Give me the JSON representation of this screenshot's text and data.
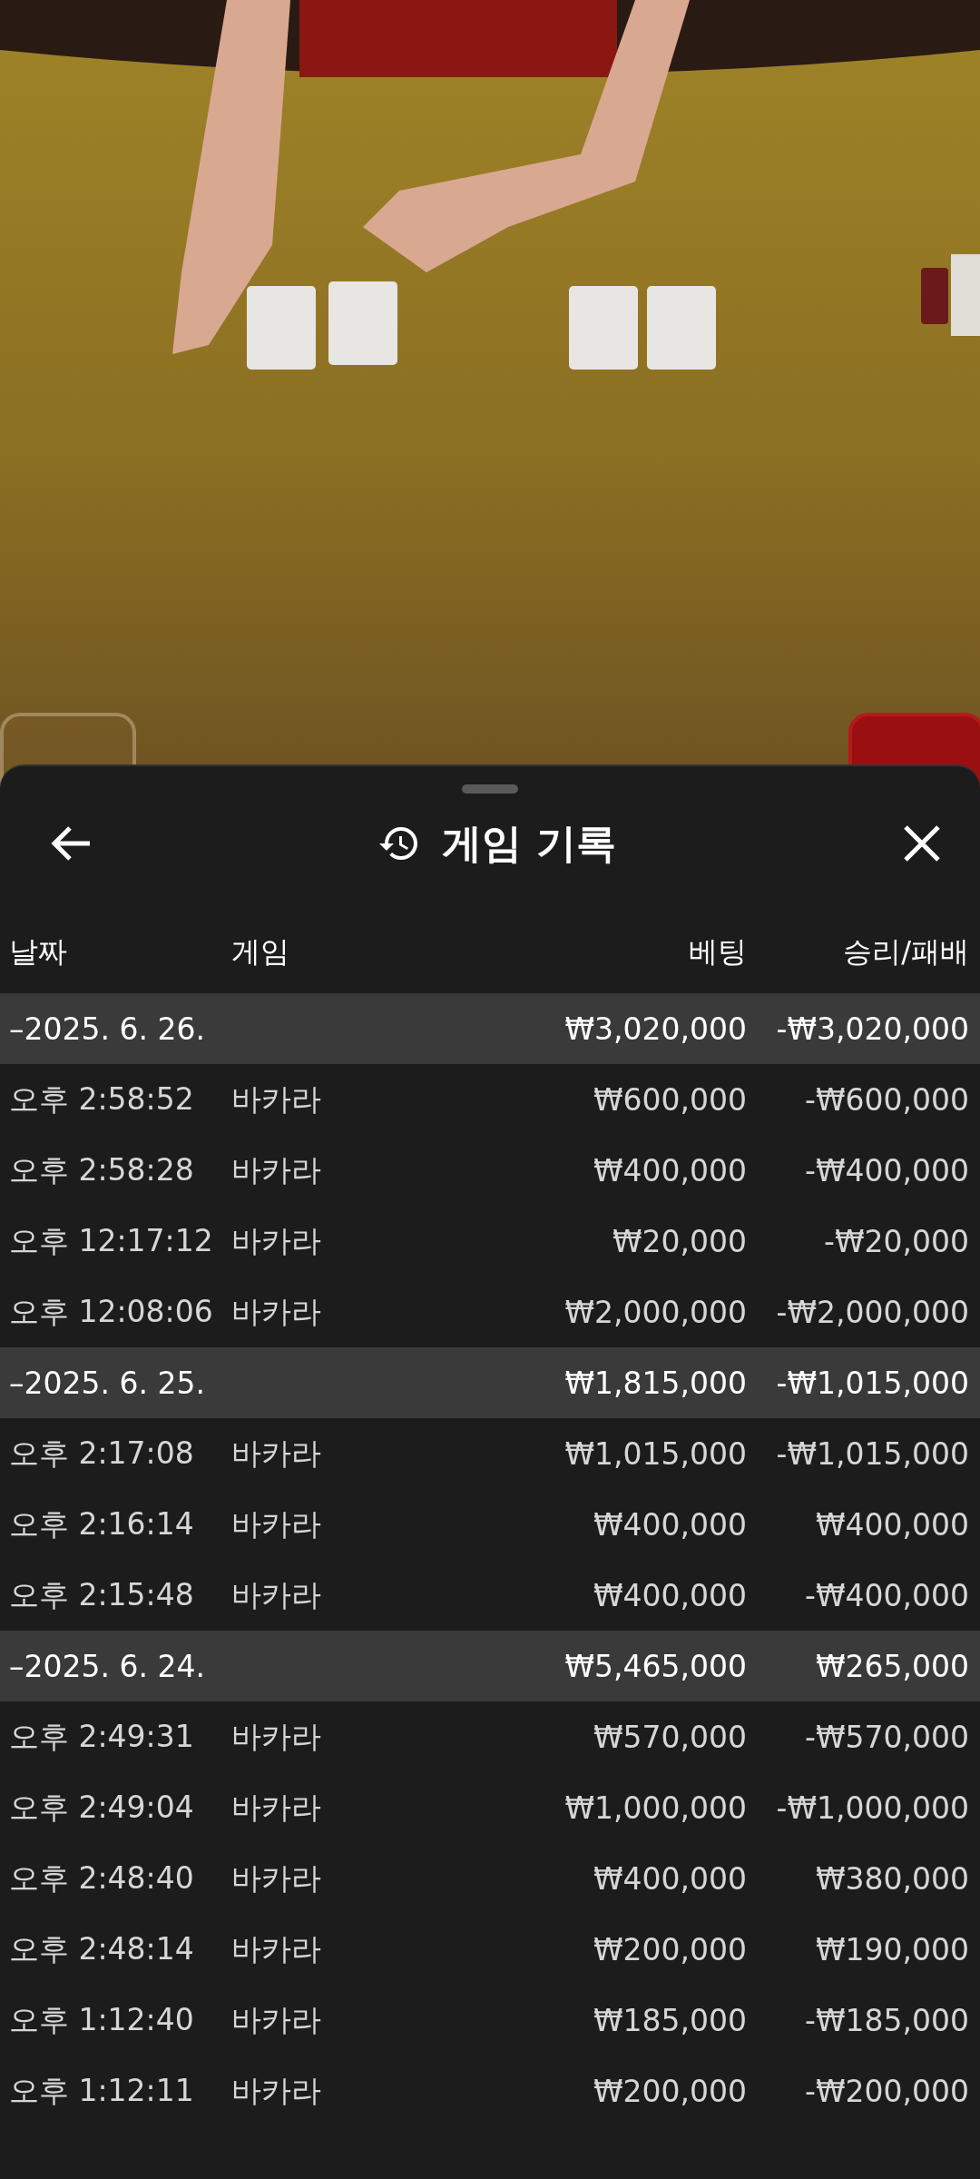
{
  "sheet": {
    "title": "게임 기록"
  },
  "table": {
    "columns": [
      "날짜",
      "게임",
      "베팅",
      "승리/패배"
    ],
    "groups": [
      {
        "date": "–2025. 6. 26.",
        "bet": "₩3,020,000",
        "result": "-₩3,020,000",
        "rows": [
          {
            "time": "오후 2:58:52",
            "game": "바카라",
            "bet": "₩600,000",
            "result": "-₩600,000"
          },
          {
            "time": "오후 2:58:28",
            "game": "바카라",
            "bet": "₩400,000",
            "result": "-₩400,000"
          },
          {
            "time": "오후 12:17:12",
            "game": "바카라",
            "bet": "₩20,000",
            "result": "-₩20,000"
          },
          {
            "time": "오후 12:08:06",
            "game": "바카라",
            "bet": "₩2,000,000",
            "result": "-₩2,000,000"
          }
        ]
      },
      {
        "date": "–2025. 6. 25.",
        "bet": "₩1,815,000",
        "result": "-₩1,015,000",
        "rows": [
          {
            "time": "오후 2:17:08",
            "game": "바카라",
            "bet": "₩1,015,000",
            "result": "-₩1,015,000"
          },
          {
            "time": "오후 2:16:14",
            "game": "바카라",
            "bet": "₩400,000",
            "result": "₩400,000"
          },
          {
            "time": "오후 2:15:48",
            "game": "바카라",
            "bet": "₩400,000",
            "result": "-₩400,000"
          }
        ]
      },
      {
        "date": "–2025. 6. 24.",
        "bet": "₩5,465,000",
        "result": "₩265,000",
        "rows": [
          {
            "time": "오후 2:49:31",
            "game": "바카라",
            "bet": "₩570,000",
            "result": "-₩570,000"
          },
          {
            "time": "오후 2:49:04",
            "game": "바카라",
            "bet": "₩1,000,000",
            "result": "-₩1,000,000"
          },
          {
            "time": "오후 2:48:40",
            "game": "바카라",
            "bet": "₩400,000",
            "result": "₩380,000"
          },
          {
            "time": "오후 2:48:14",
            "game": "바카라",
            "bet": "₩200,000",
            "result": "₩190,000"
          },
          {
            "time": "오후 1:12:40",
            "game": "바카라",
            "bet": "₩185,000",
            "result": "-₩185,000"
          },
          {
            "time": "오후 1:12:11",
            "game": "바카라",
            "bet": "₩200,000",
            "result": "-₩200,000"
          }
        ]
      }
    ]
  }
}
